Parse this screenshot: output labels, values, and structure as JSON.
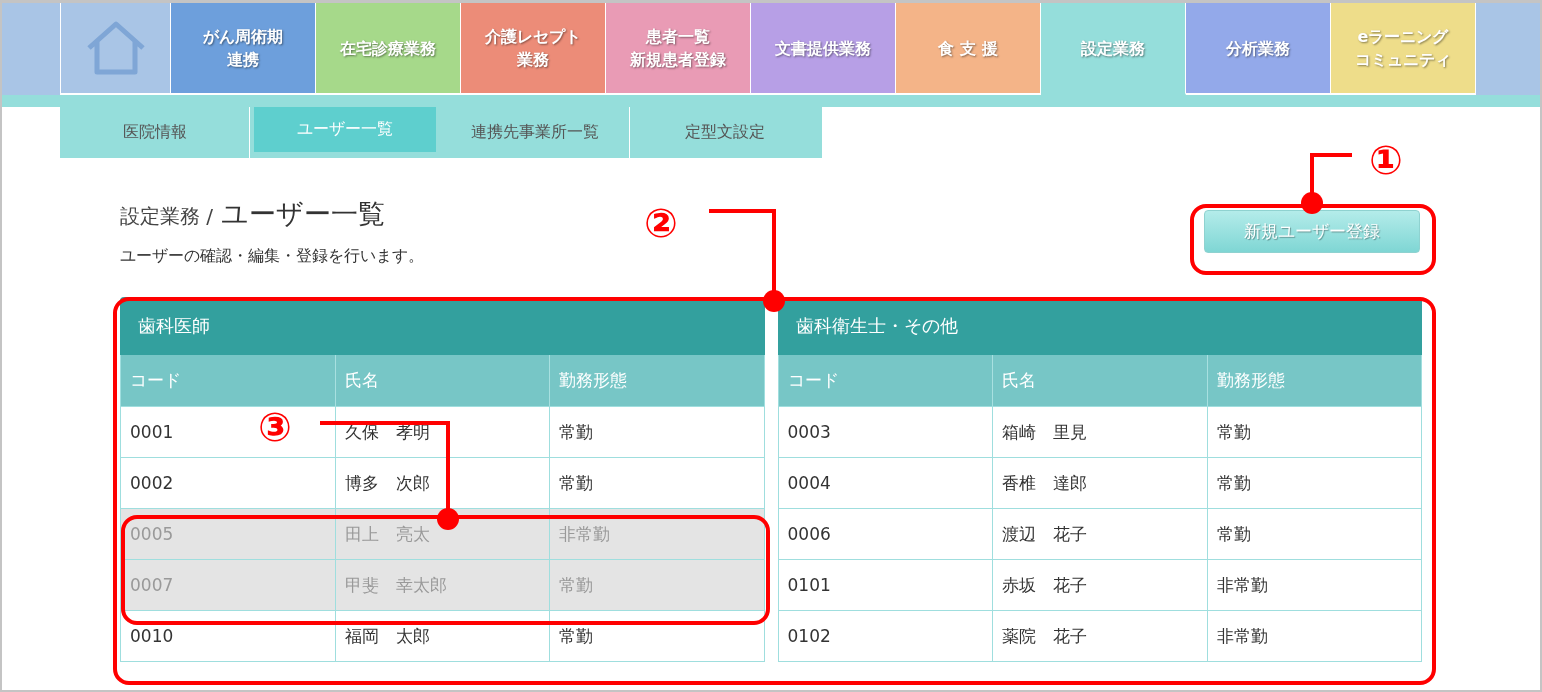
{
  "nav": [
    {
      "kind": "home",
      "color": "#a9c5e6",
      "selected": false
    },
    {
      "kind": "text",
      "lines": [
        "がん周術期",
        "連携"
      ],
      "color": "#6d9fdc",
      "selected": false
    },
    {
      "kind": "text",
      "lines": [
        "在宅診療業務"
      ],
      "color": "#a6d98a",
      "selected": false
    },
    {
      "kind": "text",
      "lines": [
        "介護レセプト",
        "業務"
      ],
      "color": "#ec8c78",
      "selected": false
    },
    {
      "kind": "text",
      "lines": [
        "患者一覧",
        "新規患者登録"
      ],
      "color": "#e99bb5",
      "selected": false
    },
    {
      "kind": "text",
      "lines": [
        "文書提供業務"
      ],
      "color": "#b79fe6",
      "selected": false
    },
    {
      "kind": "text",
      "lines": [
        "食 支 援"
      ],
      "color": "#f4b488",
      "selected": false
    },
    {
      "kind": "text",
      "lines": [
        "設定業務"
      ],
      "color": "#95dedb",
      "selected": true
    },
    {
      "kind": "text",
      "lines": [
        "分析業務"
      ],
      "color": "#93a9ea",
      "selected": false
    },
    {
      "kind": "text",
      "lines": [
        "eラーニング",
        "コミュニティ"
      ],
      "color": "#eedd8a",
      "selected": false
    }
  ],
  "subnav": [
    {
      "label": "医院情報",
      "selected": false
    },
    {
      "label": "ユーザー一覧",
      "selected": true
    },
    {
      "label": "連携先事業所一覧",
      "selected": false
    },
    {
      "label": "定型文設定",
      "selected": false
    }
  ],
  "page": {
    "breadcrumb": "設定業務 /",
    "title": "ユーザー一覧",
    "description": "ユーザーの確認・編集・登録を行います。",
    "new_button": "新規ユーザー登録"
  },
  "tables": [
    {
      "title": "歯科医師",
      "columns": [
        "コード",
        "氏名",
        "勤務形態"
      ],
      "rows": [
        {
          "cells": [
            "0001",
            "久保　孝明",
            "常勤"
          ],
          "disabled": false
        },
        {
          "cells": [
            "0002",
            "博多　次郎",
            "常勤"
          ],
          "disabled": false
        },
        {
          "cells": [
            "0005",
            "田上　亮太",
            "非常勤"
          ],
          "disabled": true
        },
        {
          "cells": [
            "0007",
            "甲斐　幸太郎",
            "常勤"
          ],
          "disabled": true
        },
        {
          "cells": [
            "0010",
            "福岡　太郎",
            "常勤"
          ],
          "disabled": false
        }
      ]
    },
    {
      "title": "歯科衛生士・その他",
      "columns": [
        "コード",
        "氏名",
        "勤務形態"
      ],
      "rows": [
        {
          "cells": [
            "0003",
            "箱崎　里見",
            "常勤"
          ],
          "disabled": false
        },
        {
          "cells": [
            "0004",
            "香椎　達郎",
            "常勤"
          ],
          "disabled": false
        },
        {
          "cells": [
            "0006",
            "渡辺　花子",
            "常勤"
          ],
          "disabled": false
        },
        {
          "cells": [
            "0101",
            "赤坂　花子",
            "非常勤"
          ],
          "disabled": false
        },
        {
          "cells": [
            "0102",
            "薬院　花子",
            "非常勤"
          ],
          "disabled": false
        }
      ]
    }
  ],
  "annotations": [
    {
      "label": "①"
    },
    {
      "label": "②"
    },
    {
      "label": "③"
    }
  ]
}
